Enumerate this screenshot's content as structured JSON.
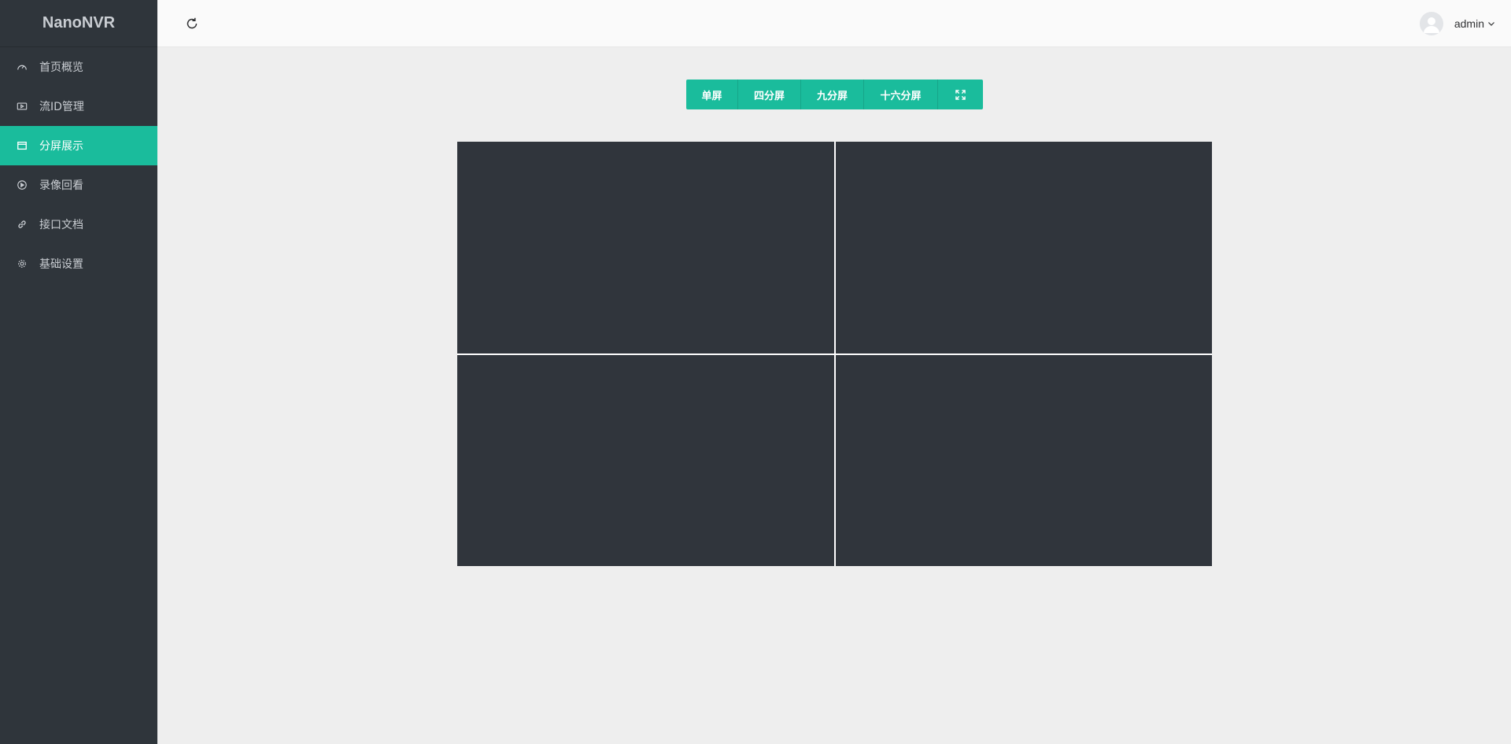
{
  "brand": "NanoNVR",
  "nav": [
    {
      "label": "首页概览",
      "icon": "dashboard-icon"
    },
    {
      "label": "流ID管理",
      "icon": "video-icon"
    },
    {
      "label": "分屏展示",
      "icon": "window-icon",
      "active": true
    },
    {
      "label": "录像回看",
      "icon": "play-circle-icon"
    },
    {
      "label": "接口文档",
      "icon": "link-icon"
    },
    {
      "label": "基础设置",
      "icon": "gear-icon"
    }
  ],
  "header": {
    "refresh_icon": "refresh-icon",
    "username": "admin"
  },
  "layout_buttons": [
    "单屏",
    "四分屏",
    "九分屏",
    "十六分屏"
  ],
  "fullscreen_icon": "fullscreen-icon",
  "colors": {
    "sidebar_bg": "#2f353b",
    "accent": "#1abc9c",
    "video_cell": "#30353c"
  }
}
